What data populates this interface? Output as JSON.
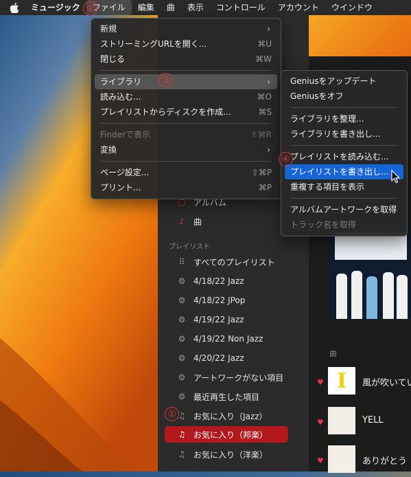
{
  "menubar": {
    "app_name": "ミュージック",
    "items": [
      "ファイル",
      "編集",
      "曲",
      "表示",
      "コントロール",
      "アカウント",
      "ウインドウ"
    ]
  },
  "file_menu": {
    "items": [
      {
        "label": "新規",
        "shortcut": "",
        "submenu": true
      },
      {
        "label": "ストリーミングURLを開く...",
        "shortcut": "⌘U"
      },
      {
        "label": "閉じる",
        "shortcut": "⌘W"
      },
      {
        "label": "ライブラリ",
        "shortcut": "",
        "submenu": true
      },
      {
        "label": "読み込む...",
        "shortcut": "⌘O"
      },
      {
        "label": "プレイリストからディスクを作成...",
        "shortcut": "⌘S"
      },
      {
        "label": "Finderで表示",
        "shortcut": "⇧⌘R"
      },
      {
        "label": "変換",
        "shortcut": "",
        "submenu": true
      },
      {
        "label": "ページ設定...",
        "shortcut": "⇧⌘P"
      },
      {
        "label": "プリント...",
        "shortcut": "⌘P"
      }
    ]
  },
  "library_menu": {
    "items": [
      "Geniusをアップデート",
      "Geniusをオフ",
      "ライブラリを整理...",
      "ライブラリを書き出し...",
      "プレイリストを読み込む...",
      "プレイリストを書き出し...",
      "重複する項目を表示",
      "アルバムアートワークを取得",
      "トラック名を取得"
    ]
  },
  "sidebar": {
    "library_items": [
      "アルバム",
      "曲"
    ],
    "playlists_heading": "プレイリスト",
    "playlists": [
      "すべてのプレイリスト",
      "4/18/22 Jazz",
      "4/18/22 JPop",
      "4/19/22 Jazz",
      "4/19/22 Non Jazz",
      "4/20/22 Jazz",
      "アートワークがない項目",
      "最近再生した項目",
      "お気に入り（Jazz）",
      "お気に入り（邦楽）",
      "お気に入り（洋楽）"
    ]
  },
  "content": {
    "section_label": "曲",
    "songs": [
      {
        "title": "風が吹いてい"
      },
      {
        "title": "YELL"
      },
      {
        "title": "ありがとう"
      }
    ],
    "art_text": "I"
  },
  "badges": [
    "②",
    "③",
    "④",
    "①"
  ]
}
